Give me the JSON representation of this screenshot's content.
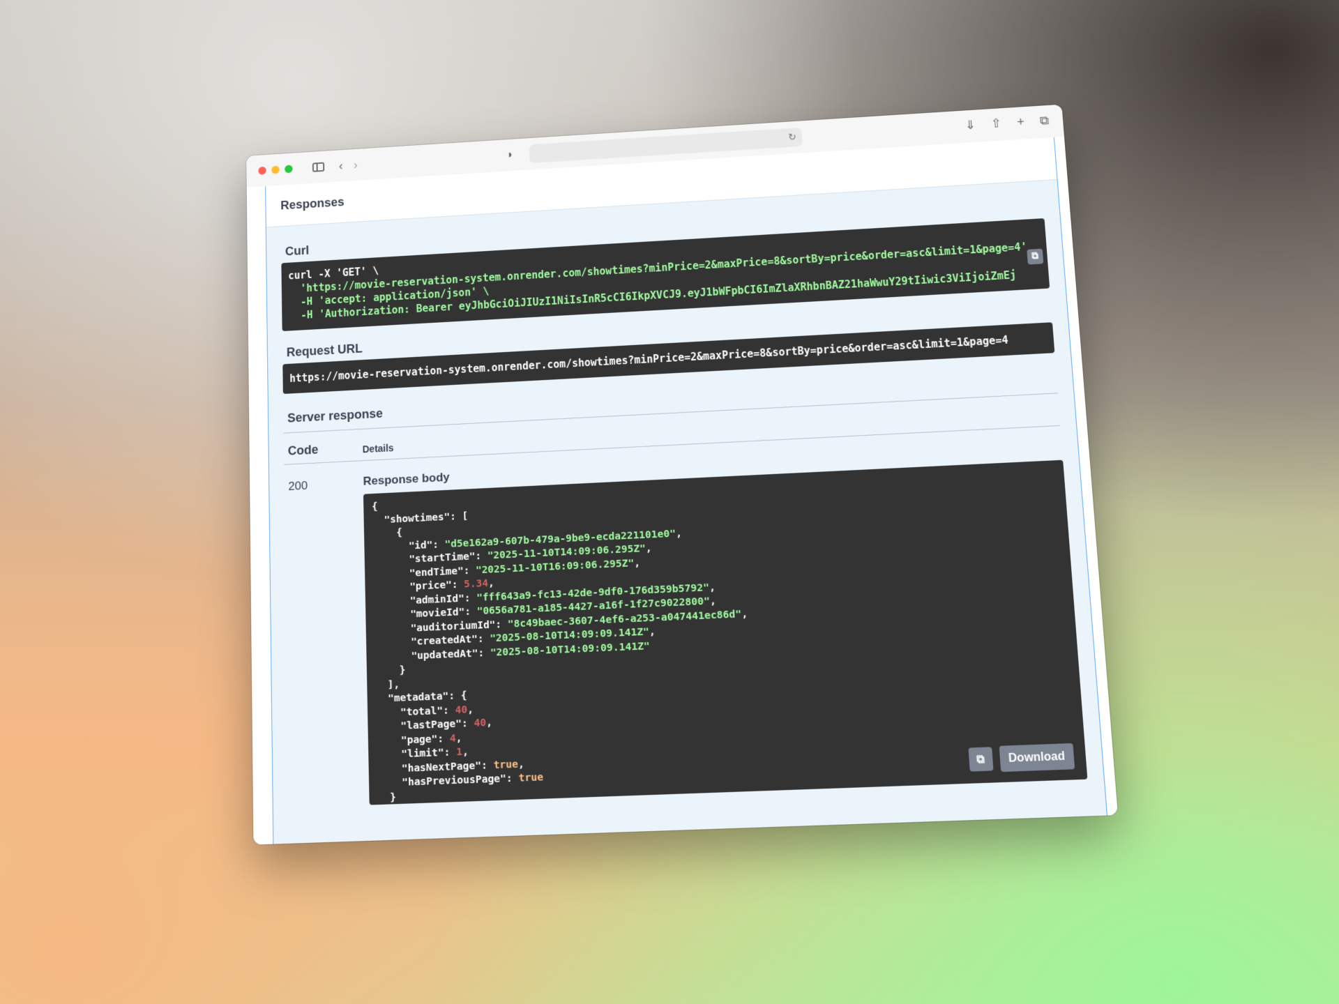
{
  "section": {
    "title": "Responses"
  },
  "curl": {
    "label": "Curl",
    "line1": "curl -X 'GET' \\",
    "url_line": "  'https://movie-reservation-system.onrender.com/showtimes?minPrice=2&maxPrice=8&sortBy=price&order=asc&limit=1&page=4'",
    "accept_line": "  -H 'accept: application/json' \\",
    "auth_line": "  -H 'Authorization: Bearer eyJhbGciOiJIUzI1NiIsInR5cCI6IkpXVCJ9.eyJ1bWFpbCI6ImZlaXRhbnBAZ21haWwuY29tIiwic3ViIjoiZmEj"
  },
  "request_url": {
    "label": "Request URL",
    "value": "https://movie-reservation-system.onrender.com/showtimes?minPrice=2&maxPrice=8&sortBy=price&order=asc&limit=1&page=4"
  },
  "server_response": {
    "title": "Server response",
    "code_header": "Code",
    "details_header": "Details",
    "status_code": "200",
    "body_label": "Response body",
    "download_label": "Download"
  },
  "showtime": {
    "id": "\"d5e162a9-607b-479a-9be9-ecda221101e0\"",
    "startTime": "\"2025-11-10T14:09:06.295Z\"",
    "endTime": "\"2025-11-10T16:09:06.295Z\"",
    "price": "5.34",
    "adminId": "\"fff643a9-fc13-42de-9df0-176d359b5792\"",
    "movieId": "\"0656a781-a185-4427-a16f-1f27c9022800\"",
    "auditoriumId": "\"8c49baec-3607-4ef6-a253-a047441ec86d\"",
    "createdAt": "\"2025-08-10T14:09:09.141Z\"",
    "updatedAt": "\"2025-08-10T14:09:09.141Z\""
  },
  "metadata": {
    "total": "40",
    "lastPage": "40",
    "page": "4",
    "limit": "1",
    "hasNextPage": "true",
    "hasPreviousPage": "true"
  }
}
